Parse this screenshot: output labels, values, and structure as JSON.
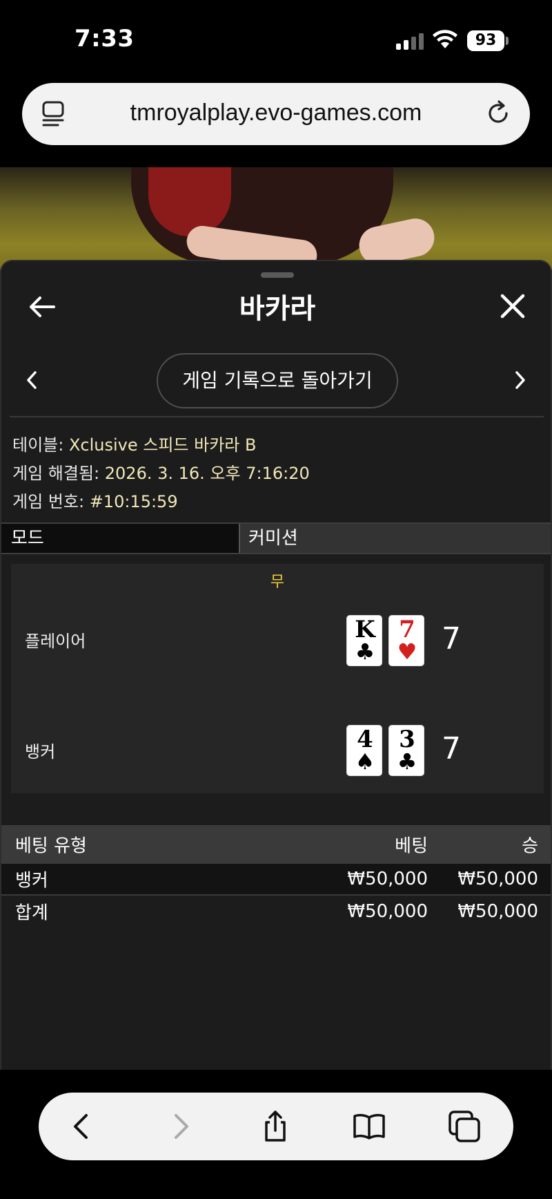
{
  "status": {
    "time": "7:33",
    "battery": "93"
  },
  "browser": {
    "url": "tmroyalplay.evo-games.com"
  },
  "panel": {
    "title": "바카라",
    "history_button": "게임 기록으로 돌아가기"
  },
  "info": {
    "table_label": "테이블:",
    "table_value": "Xclusive 스피드 바카라 B",
    "resolved_label": "게임 해결됨:",
    "resolved_value": "2026. 3. 16. 오후 7:16:20",
    "number_label": "게임 번호:",
    "number_value": "#10:15:59"
  },
  "mode": {
    "mode_label": "모드",
    "commission_label": "커미션"
  },
  "result": {
    "outcome": "무",
    "player": {
      "label": "플레이어",
      "score": "7",
      "cards": [
        {
          "rank": "K",
          "suit": "♣",
          "color": "black"
        },
        {
          "rank": "7",
          "suit": "♥",
          "color": "red"
        }
      ]
    },
    "banker": {
      "label": "뱅커",
      "score": "7",
      "cards": [
        {
          "rank": "4",
          "suit": "♠",
          "color": "black"
        },
        {
          "rank": "3",
          "suit": "♣",
          "color": "black"
        }
      ]
    }
  },
  "bets": {
    "headers": [
      "베팅 유형",
      "베팅",
      "승"
    ],
    "rows": [
      [
        "뱅커",
        "₩50,000",
        "₩50,000"
      ]
    ],
    "total": [
      "합계",
      "₩50,000",
      "₩50,000"
    ]
  }
}
